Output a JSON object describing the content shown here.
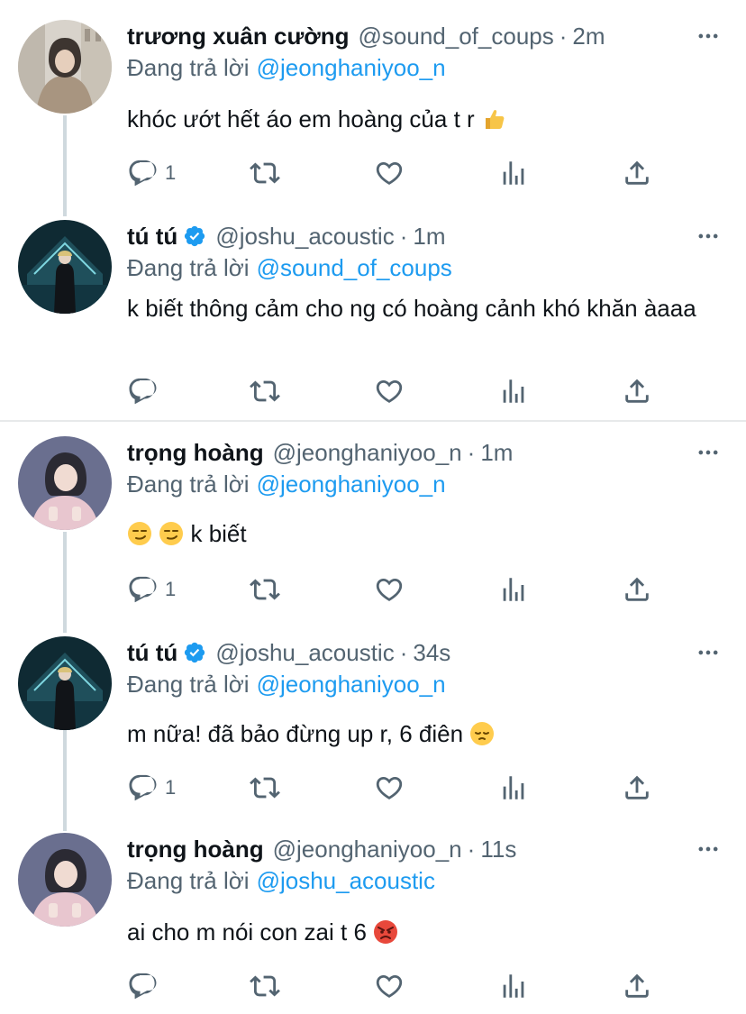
{
  "replying_prefix": "Đang trả lời",
  "tweets": [
    {
      "name": "trương xuân cường",
      "handle": "@sound_of_coups",
      "time": "2m",
      "reply_to": "@jeonghaniyoo_n",
      "text": "khóc ướt hết áo em hoàng của t r",
      "emoji_after": "thumbs-up",
      "reply_count": "1",
      "verified": false
    },
    {
      "name": "tú tú",
      "handle": "@joshu_acoustic",
      "time": "1m",
      "reply_to": "@sound_of_coups",
      "text": "k biết thông cảm cho ng có hoàng cảnh khó khăn àaaa",
      "reply_count": "",
      "verified": true
    },
    {
      "name": "trọng hoàng",
      "handle": "@jeonghaniyoo_n",
      "time": "1m",
      "reply_to": "@jeonghaniyoo_n",
      "text": "k biết",
      "emoji_before": "smirk",
      "reply_count": "1",
      "verified": false
    },
    {
      "name": "tú tú",
      "handle": "@joshu_acoustic",
      "time": "34s",
      "reply_to": "@jeonghaniyoo_n",
      "text": "m nữa! đã bảo đừng up r, 6 điên",
      "emoji_after": "pensive",
      "reply_count": "1",
      "verified": true
    },
    {
      "name": "trọng hoàng",
      "handle": "@jeonghaniyoo_n",
      "time": "11s",
      "reply_to": "@joshu_acoustic",
      "text": "ai cho m nói con zai t 6",
      "emoji_after": "angry",
      "reply_count": "",
      "verified": false
    }
  ],
  "colors": {
    "link": "#1d9bf0",
    "secondary_text": "#536471",
    "primary_text": "#0f1419",
    "thread_line": "#cfd9de",
    "separator": "#e7e9ea"
  },
  "icons": [
    "reply-icon",
    "retweet-icon",
    "like-icon",
    "analytics-icon",
    "share-icon",
    "more-icon",
    "verified-badge-icon"
  ]
}
